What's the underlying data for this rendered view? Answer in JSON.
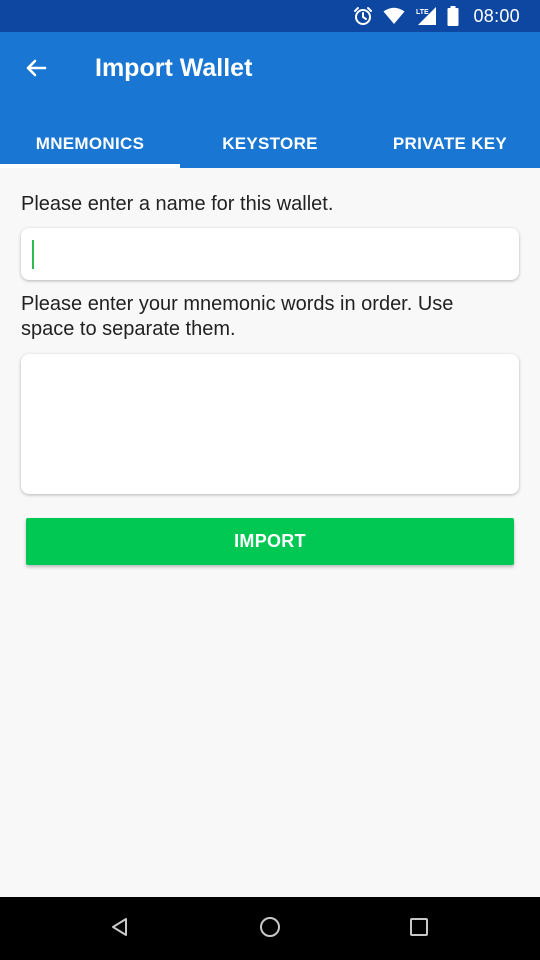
{
  "status_bar": {
    "time": "08:00",
    "network": "LTE",
    "icons": [
      "alarm-icon",
      "wifi-icon",
      "signal-icon",
      "battery-icon"
    ]
  },
  "app_bar": {
    "title": "Import Wallet",
    "back_icon": "arrow-back-icon"
  },
  "tabs": [
    {
      "label": "MNEMONICS",
      "active": true
    },
    {
      "label": "KEYSTORE",
      "active": false
    },
    {
      "label": "PRIVATE KEY",
      "active": false
    }
  ],
  "form": {
    "name_label": "Please enter a name for this wallet.",
    "name_value": "",
    "mnemonic_label": "Please enter your mnemonic words in order. Use space to separate them.",
    "mnemonic_value": "",
    "import_label": "IMPORT"
  },
  "nav_bar": {
    "icons": [
      "back-triangle-icon",
      "home-circle-icon",
      "recents-square-icon"
    ]
  },
  "colors": {
    "status_bar": "#0d47a1",
    "app_bar": "#1976d2",
    "import_button": "#00c853",
    "caret": "#2ebc4f",
    "background": "#f8f8f8"
  }
}
